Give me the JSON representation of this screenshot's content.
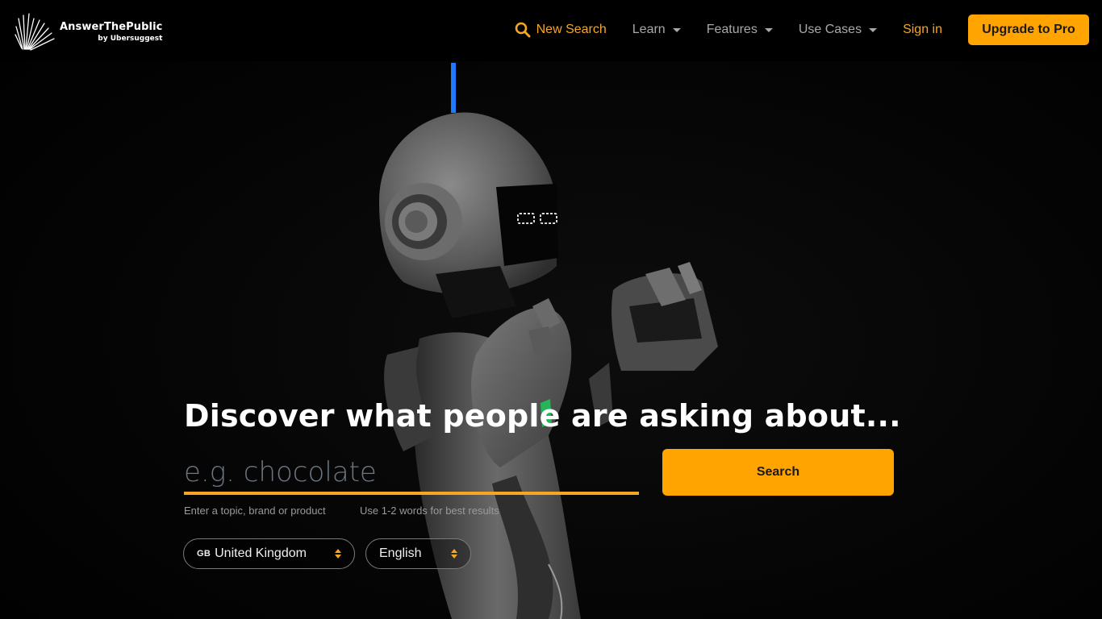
{
  "brand": {
    "name": "AnswerThePublic",
    "byline": "by Ubersuggest"
  },
  "nav": {
    "new_search": "New Search",
    "learn": "Learn",
    "features": "Features",
    "use_cases": "Use Cases",
    "sign_in": "Sign in",
    "upgrade": "Upgrade to Pro",
    "icons": {
      "new_search": "search-icon",
      "dropdown": "caret-down-icon"
    }
  },
  "hero": {
    "title": "Discover what people are asking about...",
    "search": {
      "value": "",
      "placeholder": "e.g. chocolate",
      "button_label": "Search",
      "hint_primary": "Enter a topic, brand or product",
      "hint_secondary": "Use 1-2 words for best results"
    },
    "country_select": {
      "flag_code": "GB",
      "selected": "United Kingdom"
    },
    "language_select": {
      "selected": "English"
    },
    "background_image": "robot-illustration"
  },
  "colors": {
    "accent": "#ffa400",
    "accent_text": "#f5a623",
    "nav_text": "#a8a8a8",
    "background": "#000000",
    "placeholder": "#6d7680"
  }
}
